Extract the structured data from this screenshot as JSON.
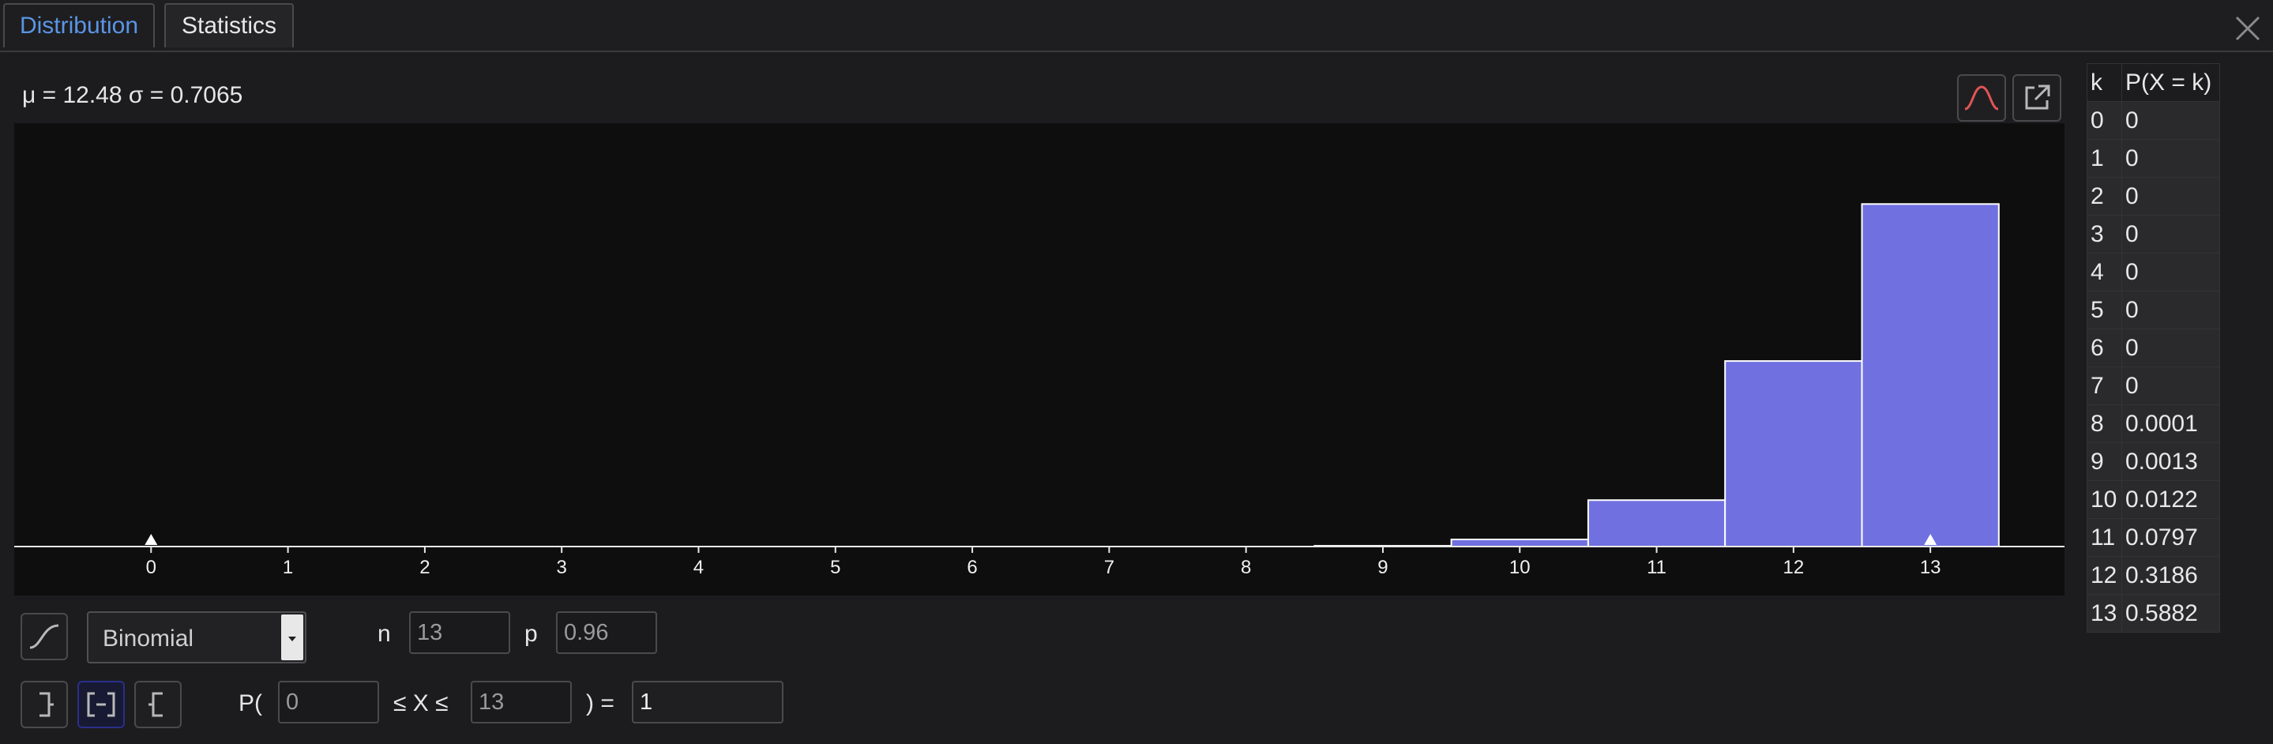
{
  "tabs": [
    {
      "label": "Distribution",
      "active": true
    },
    {
      "label": "Statistics",
      "active": false
    }
  ],
  "stats_text": "μ = 12.48 σ = 0.7065",
  "chart_data": {
    "type": "bar",
    "categories": [
      "0",
      "1",
      "2",
      "3",
      "4",
      "5",
      "6",
      "7",
      "8",
      "9",
      "10",
      "11",
      "12",
      "13"
    ],
    "values": [
      0,
      0,
      0,
      0,
      0,
      0,
      0,
      0,
      0.0001,
      0.0013,
      0.0122,
      0.0797,
      0.3186,
      0.5882
    ],
    "x_range": [
      -1,
      13.98
    ],
    "y_range": [
      0,
      0.727
    ],
    "grid": false,
    "bar_color": "#7070e0",
    "bar_edge_color": "#ffffff",
    "markers_at": [
      0,
      13
    ]
  },
  "table": {
    "headers": [
      "k",
      "P(X = k)"
    ],
    "rows": [
      [
        "0",
        "0"
      ],
      [
        "1",
        "0"
      ],
      [
        "2",
        "0"
      ],
      [
        "3",
        "0"
      ],
      [
        "4",
        "0"
      ],
      [
        "5",
        "0"
      ],
      [
        "6",
        "0"
      ],
      [
        "7",
        "0"
      ],
      [
        "8",
        "0.0001"
      ],
      [
        "9",
        "0.0013"
      ],
      [
        "10",
        "0.0122"
      ],
      [
        "11",
        "0.0797"
      ],
      [
        "12",
        "0.3186"
      ],
      [
        "13",
        "0.5882"
      ]
    ]
  },
  "distribution": {
    "selected": "Binomial",
    "n_label": "n",
    "n_value": "13",
    "p_label": "p",
    "p_value": "0.96"
  },
  "probability": {
    "prefix": "P(",
    "lower": "0",
    "middle": "≤ X ≤",
    "upper": "13",
    "suffix": ") =",
    "result": "1"
  },
  "colors": {
    "accent": "#5b95e6",
    "normal_curve_icon": "#e05555"
  },
  "icons": {
    "close": "close-icon",
    "normal_overlay": "normal-curve-icon",
    "export": "export-icon",
    "cumulative": "cumulative-curve-icon",
    "left_sided": "left-sided-icon",
    "interval": "interval-icon",
    "right_sided": "right-sided-icon"
  }
}
